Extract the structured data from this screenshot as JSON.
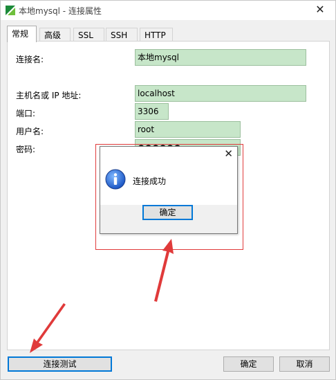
{
  "window": {
    "title": "本地mysql - 连接属性"
  },
  "tabs": [
    {
      "label": "常规",
      "active": true
    },
    {
      "label": "高级",
      "active": false
    },
    {
      "label": "SSL",
      "active": false
    },
    {
      "label": "SSH",
      "active": false
    },
    {
      "label": "HTTP",
      "active": false
    }
  ],
  "form": {
    "connection_name_label": "连接名:",
    "connection_name": "本地mysql",
    "host_label": "主机名或 IP 地址:",
    "host": "localhost",
    "port_label": "端口:",
    "port": "3306",
    "user_label": "用户名:",
    "user": "root",
    "password_label": "密码:",
    "password_mask": "●●●●●●"
  },
  "dialog": {
    "message": "连接成功",
    "ok_label": "确定"
  },
  "footer": {
    "test_label": "连接测试",
    "ok_label": "确定",
    "cancel_label": "取消"
  },
  "colors": {
    "field_bg": "#c7e6c9",
    "highlight_red": "#e03a3a",
    "focus_blue": "#0078d7"
  }
}
